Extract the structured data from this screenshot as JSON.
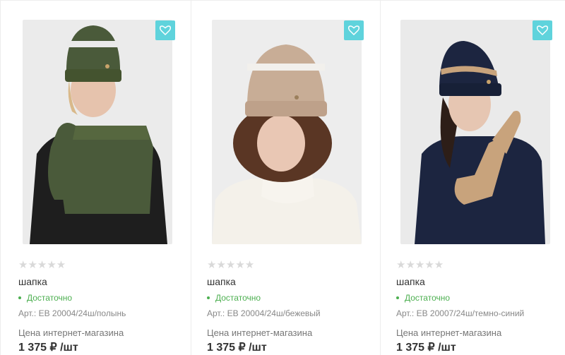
{
  "products": [
    {
      "rating_stars": "★★★★★",
      "name": "шапка",
      "stock": "Достаточно",
      "article": "Арт.: EB 20004/24ш/полынь",
      "price_label": "Цена интернет-магазина",
      "price": "1 375 ₽ /шт",
      "hat_color": "#4a5a3a",
      "image_bg": "#ebebeb"
    },
    {
      "rating_stars": "★★★★★",
      "name": "шапка",
      "stock": "Достаточно",
      "article": "Арт.: EB 20004/24ш/бежевый",
      "price_label": "Цена интернет-магазина",
      "price": "1 375 ₽ /шт",
      "hat_color": "#c8ad96",
      "image_bg": "#ededed"
    },
    {
      "rating_stars": "★★★★★",
      "name": "шапка",
      "stock": "Достаточно",
      "article": "Арт.: EB 20007/24ш/темно-синий",
      "price_label": "Цена интернет-магазина",
      "price": "1 375 ₽ /шт",
      "hat_color": "#1c2540",
      "image_bg": "#eaeaea"
    }
  ],
  "colors": {
    "accent": "#5fd3dc",
    "stock_green": "#4caf50"
  },
  "icons": {
    "favorite": "heart-icon"
  }
}
